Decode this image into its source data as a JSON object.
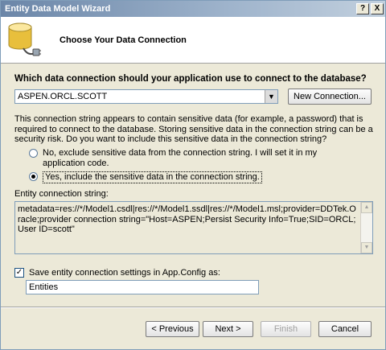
{
  "window": {
    "title": "Entity Data Model Wizard",
    "help_glyph": "?",
    "close_glyph": "X"
  },
  "header": {
    "heading": "Choose Your Data Connection",
    "icon": "database-plug-icon"
  },
  "question": "Which data connection should your application use to connect to the database?",
  "connection": {
    "selected": "ASPEN.ORCL.SCOTT",
    "new_connection_label": "New Connection..."
  },
  "sensitive_note": "This connection string appears to contain sensitive data (for example, a password) that is required to connect to the database. Storing sensitive data in the connection string can be a security risk. Do you want to include this sensitive data in the connection string?",
  "options": {
    "exclude": {
      "label": "No, exclude sensitive data from the connection string. I will set it in my application code.",
      "selected": false
    },
    "include": {
      "label": "Yes, include the sensitive data in the connection string.",
      "selected": true
    }
  },
  "entity_connection": {
    "label": "Entity connection string:",
    "value": "metadata=res://*/Model1.csdl|res://*/Model1.ssdl|res://*/Model1.msl;provider=DDTek.Oracle;provider connection string=\"Host=ASPEN;Persist Security Info=True;SID=ORCL;User ID=scott\""
  },
  "save_config": {
    "checked": true,
    "label": "Save entity connection settings in App.Config as:",
    "value": "Entities"
  },
  "buttons": {
    "previous": "< Previous",
    "next": "Next >",
    "finish": "Finish",
    "cancel": "Cancel"
  },
  "colors": {
    "titlebar": "#6b86a8",
    "dialog_bg": "#ece9d8",
    "input_border": "#7f9db9"
  }
}
